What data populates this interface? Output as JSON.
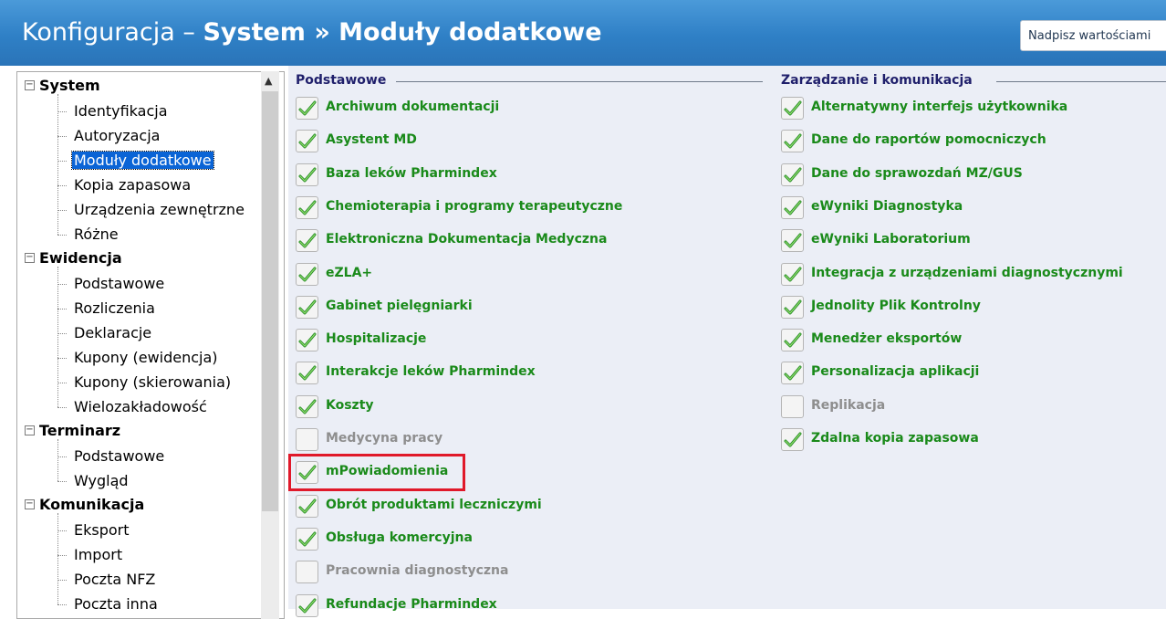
{
  "window": {
    "title_prefix": "Konfiguracja – ",
    "title_bold": "System » Moduły dodatkowe",
    "override_button": "Nadpisz wartościami"
  },
  "tree": {
    "groups": [
      {
        "label": "System",
        "items": [
          "Identyfikacja",
          "Autoryzacja",
          "Moduły dodatkowe",
          "Kopia zapasowa",
          "Urządzenia zewnętrzne",
          "Różne"
        ]
      },
      {
        "label": "Ewidencja",
        "items": [
          "Podstawowe",
          "Rozliczenia",
          "Deklaracje",
          "Kupony (ewidencja)",
          "Kupony (skierowania)",
          "Wielozakładowość"
        ]
      },
      {
        "label": "Terminarz",
        "items": [
          "Podstawowe",
          "Wygląd"
        ]
      },
      {
        "label": "Komunikacja",
        "items": [
          "Eksport",
          "Import",
          "Poczta NFZ",
          "Poczta inna"
        ]
      }
    ],
    "selected": "Moduły dodatkowe"
  },
  "sections": {
    "basic": {
      "title": "Podstawowe",
      "items": [
        {
          "label": "Archiwum dokumentacji",
          "checked": true
        },
        {
          "label": "Asystent MD",
          "checked": true
        },
        {
          "label": "Baza leków Pharmindex",
          "checked": true
        },
        {
          "label": "Chemioterapia i programy terapeutyczne",
          "checked": true
        },
        {
          "label": "Elektroniczna Dokumentacja Medyczna",
          "checked": true
        },
        {
          "label": "eZLA+",
          "checked": true
        },
        {
          "label": "Gabinet pielęgniarki",
          "checked": true
        },
        {
          "label": "Hospitalizacje",
          "checked": true
        },
        {
          "label": "Interakcje leków Pharmindex",
          "checked": true
        },
        {
          "label": "Koszty",
          "checked": true
        },
        {
          "label": "Medycyna pracy",
          "checked": false
        },
        {
          "label": "mPowiadomienia",
          "checked": true
        },
        {
          "label": "Obrót produktami leczniczymi",
          "checked": true
        },
        {
          "label": "Obsługa komercyjna",
          "checked": true
        },
        {
          "label": "Pracownia diagnostyczna",
          "checked": false
        },
        {
          "label": "Refundacje Pharmindex",
          "checked": true
        }
      ]
    },
    "management": {
      "title": "Zarządzanie i komunikacja",
      "items": [
        {
          "label": "Alternatywny interfejs użytkownika",
          "checked": true
        },
        {
          "label": "Dane do raportów pomocniczych",
          "checked": true
        },
        {
          "label": "Dane do sprawozdań MZ/GUS",
          "checked": true
        },
        {
          "label": "eWyniki Diagnostyka",
          "checked": true
        },
        {
          "label": "eWyniki Laboratorium",
          "checked": true
        },
        {
          "label": "Integracja z urządzeniami diagnostycznymi",
          "checked": true
        },
        {
          "label": "Jednolity Plik Kontrolny",
          "checked": true
        },
        {
          "label": "Menedżer eksportów",
          "checked": true
        },
        {
          "label": "Personalizacja aplikacji",
          "checked": true
        },
        {
          "label": "Replikacja",
          "checked": false
        },
        {
          "label": "Zdalna kopia zapasowa",
          "checked": true
        }
      ]
    }
  },
  "highlighted_item": "mPowiadomienia",
  "colors": {
    "header": "#2f80c6",
    "enabled_label": "#1a8a1a",
    "disabled_label": "#8e8e8e",
    "highlight": "#e0192a",
    "selection": "#0a64d6"
  }
}
